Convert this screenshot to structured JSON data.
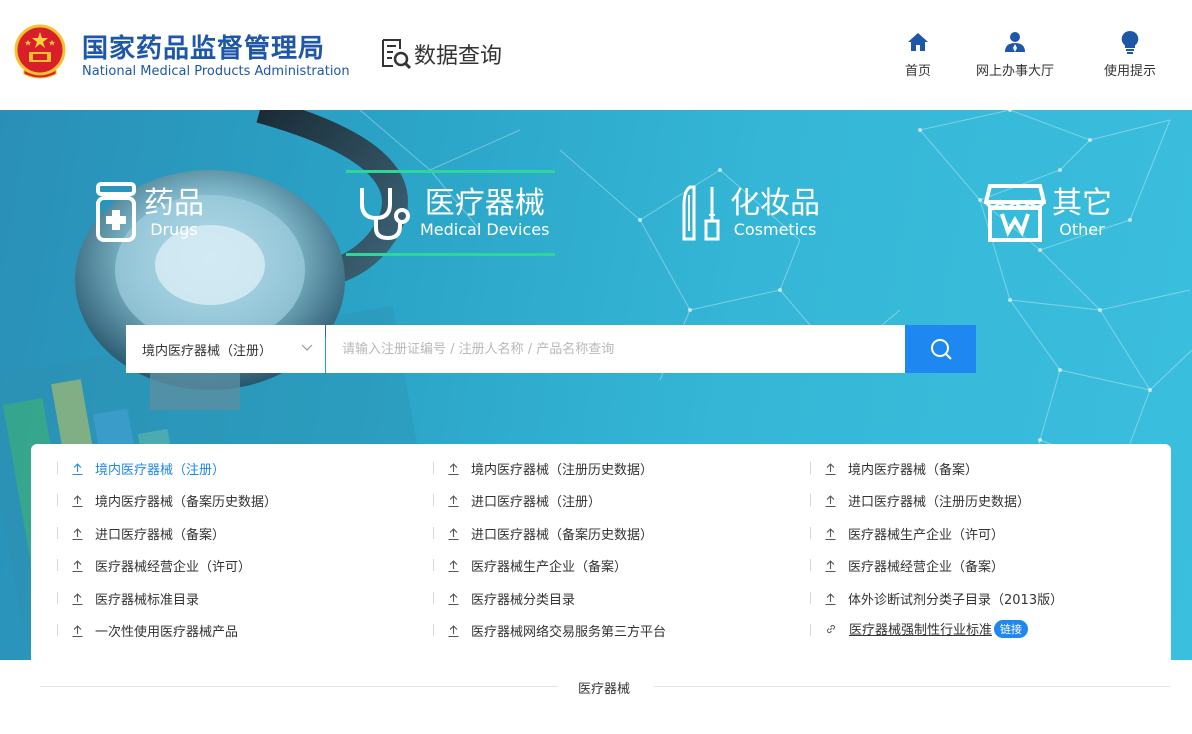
{
  "header": {
    "brand_cn": "国家药品监督管理局",
    "brand_en": "National Medical Products Administration",
    "data_query": "数据查询",
    "nav": [
      {
        "label": "首页",
        "icon": "home-icon"
      },
      {
        "label": "网上办事大厅",
        "icon": "user-icon"
      },
      {
        "label": "使用提示",
        "icon": "lightbulb-icon"
      }
    ]
  },
  "categories": [
    {
      "cn": "药品",
      "en": "Drugs",
      "icon": "medicine-bottle-icon",
      "active": false
    },
    {
      "cn": "医疗器械",
      "en": "Medical Devices",
      "icon": "stethoscope-icon",
      "active": true
    },
    {
      "cn": "化妆品",
      "en": "Cosmetics",
      "icon": "cosmetics-icon",
      "active": false
    },
    {
      "cn": "其它",
      "en": "Other",
      "icon": "store-icon",
      "active": false
    }
  ],
  "search": {
    "selected": "境内医疗器械（注册）",
    "placeholder": "请输入注册证编号 / 注册人名称 / 产品名称查询"
  },
  "links": [
    [
      "境内医疗器械（注册）",
      "境内医疗器械（注册历史数据）",
      "境内医疗器械（备案）"
    ],
    [
      "境内医疗器械（备案历史数据）",
      "进口医疗器械（注册）",
      "进口医疗器械（注册历史数据）"
    ],
    [
      "进口医疗器械（备案）",
      "进口医疗器械（备案历史数据）",
      "医疗器械生产企业（许可）"
    ],
    [
      "医疗器械经营企业（许可）",
      "医疗器械生产企业（备案）",
      "医疗器械经营企业（备案）"
    ],
    [
      "医疗器械标准目录",
      "医疗器械分类目录",
      "体外诊断试剂分类子目录（2013版）"
    ],
    [
      "一次性使用医疗器械产品",
      "医疗器械网络交易服务第三方平台",
      "医疗器械强制性行业标准"
    ]
  ],
  "link_badge": "链接",
  "section_title": "医疗器械",
  "colors": {
    "brand": "#1f57a8",
    "accent": "#1e87f0",
    "active_bar": "#2ed69a"
  }
}
